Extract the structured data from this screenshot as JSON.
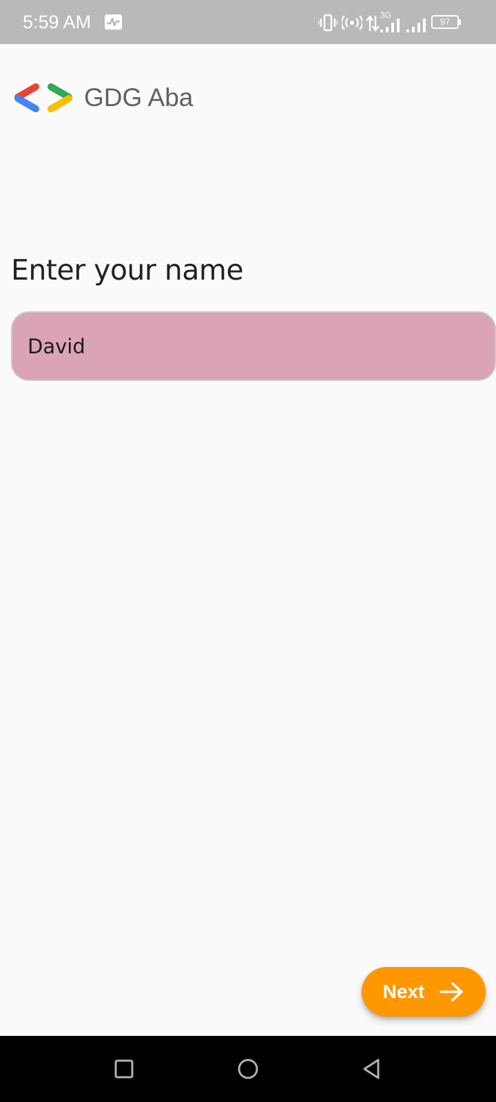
{
  "status_bar": {
    "time": "5:59 AM",
    "network_type": "3G",
    "battery_level": "97",
    "icons": [
      "activity-icon",
      "vibrate-icon",
      "hotspot-icon",
      "data-arrows-icon",
      "signal-icon",
      "signal-icon",
      "battery-icon"
    ]
  },
  "logo": {
    "text": "GDG Aba",
    "colors": {
      "red": "#ea4335",
      "blue": "#4285f4",
      "green": "#34a853",
      "yellow": "#fbbc04"
    }
  },
  "main": {
    "title": "Enter your name",
    "name_field": {
      "value": "David",
      "background": "#dba4b6"
    }
  },
  "fab": {
    "label": "Next",
    "icon": "arrow-right-icon",
    "color": "#ff9700"
  },
  "nav_bar": {
    "buttons": [
      "recents-icon",
      "home-icon",
      "back-icon"
    ]
  }
}
